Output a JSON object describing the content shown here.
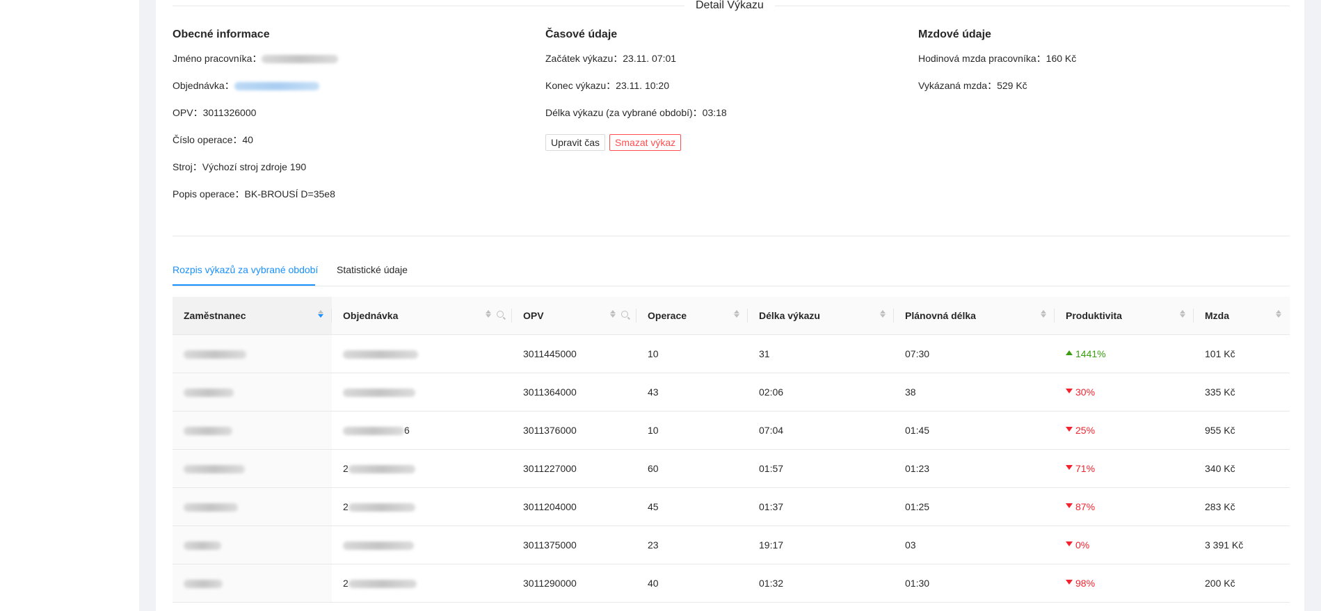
{
  "detail": {
    "title": "Detail Výkazu",
    "general": {
      "heading": "Obecné informace",
      "worker_label": "Jméno pracovníka：",
      "order_label": "Objednávka：",
      "opv_label": "OPV：",
      "opv_value": "3011326000",
      "operation_label": "Číslo operace：",
      "operation_value": "40",
      "machine_label": "Stroj：",
      "machine_value": "Výchozí stroj zdroje 190",
      "description_label": "Popis operace：",
      "description_value": "BK-BROUSÍ D=35e8"
    },
    "time": {
      "heading": "Časové údaje",
      "start_label": "Začátek výkazu：",
      "start_value": "23.11. 07:01",
      "end_label": "Konec výkazu：",
      "end_value": "23.11. 10:20",
      "duration_label": "Délka výkazu (za vybrané období)：",
      "duration_value": "03:18",
      "edit_button": "Upravit čas",
      "delete_button": "Smazat výkaz"
    },
    "wage": {
      "heading": "Mzdové údaje",
      "hourly_label": "Hodinová mzda pracovníka：",
      "hourly_value": "160 Kč",
      "reported_label": "Vykázaná mzda：",
      "reported_value": "529 Kč"
    }
  },
  "tabs": [
    {
      "label": "Rozpis výkazů za vybrané období",
      "active": true
    },
    {
      "label": "Statistické údaje",
      "active": false
    }
  ],
  "table": {
    "columns": [
      {
        "label": "Zaměstnanec",
        "sorted": "descend",
        "search": false
      },
      {
        "label": "Objednávka",
        "sorted": null,
        "search": true
      },
      {
        "label": "OPV",
        "sorted": null,
        "search": true
      },
      {
        "label": "Operace",
        "sorted": null,
        "search": false
      },
      {
        "label": "Délka výkazu",
        "sorted": null,
        "search": false
      },
      {
        "label": "Plánovná délka",
        "sorted": null,
        "search": false
      },
      {
        "label": "Produktivita",
        "sorted": null,
        "search": false
      },
      {
        "label": "Mzda",
        "sorted": null,
        "search": false
      }
    ],
    "rows": [
      {
        "opv": "3011445000",
        "operation": "10",
        "duration": "31",
        "planned": "07:30",
        "productivity": "1441%",
        "trend": "up",
        "wage": "101 Kč"
      },
      {
        "opv": "3011364000",
        "operation": "43",
        "duration": "02:06",
        "planned": "38",
        "productivity": "30%",
        "trend": "down",
        "wage": "335 Kč"
      },
      {
        "order_suffix": "6",
        "opv": "3011376000",
        "operation": "10",
        "duration": "07:04",
        "planned": "01:45",
        "productivity": "25%",
        "trend": "down",
        "wage": "955 Kč"
      },
      {
        "order_prefix": "2",
        "opv": "3011227000",
        "operation": "60",
        "duration": "01:57",
        "planned": "01:23",
        "productivity": "71%",
        "trend": "down",
        "wage": "340 Kč"
      },
      {
        "order_prefix": "2",
        "opv": "3011204000",
        "operation": "45",
        "duration": "01:37",
        "planned": "01:25",
        "productivity": "87%",
        "trend": "down",
        "wage": "283 Kč"
      },
      {
        "opv": "3011375000",
        "operation": "23",
        "duration": "19:17",
        "planned": "03",
        "productivity": "0%",
        "trend": "down",
        "wage": "3 391 Kč"
      },
      {
        "order_prefix": "2",
        "opv": "3011290000",
        "operation": "40",
        "duration": "01:32",
        "planned": "01:30",
        "productivity": "98%",
        "trend": "down",
        "wage": "200 Kč"
      }
    ]
  },
  "colors": {
    "accent": "#1890ff",
    "danger": "#ff4d4f",
    "up": "#389e0d",
    "down": "#f5222d",
    "gutter": "#f0f2f5"
  }
}
